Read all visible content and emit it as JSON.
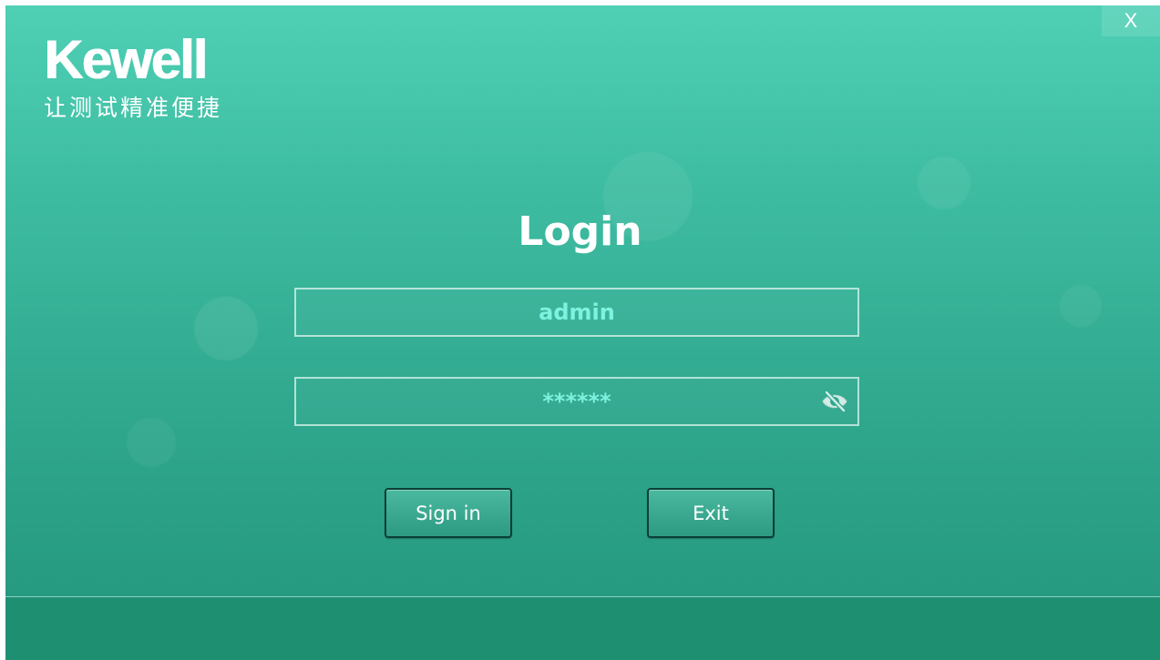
{
  "window": {
    "close_label": "X"
  },
  "logo": {
    "brand": "Kewell",
    "slogan": "让测试精准便捷"
  },
  "login": {
    "title": "Login",
    "username_value": "admin",
    "password_display": "******",
    "toggle_icon": "eye-off-icon",
    "signin_label": "Sign in",
    "exit_label": "Exit"
  },
  "colors": {
    "background_top": "#4fd0b5",
    "background_bottom": "#23957c",
    "input_text": "#7ff2df",
    "button_border": "#0b3f36"
  }
}
